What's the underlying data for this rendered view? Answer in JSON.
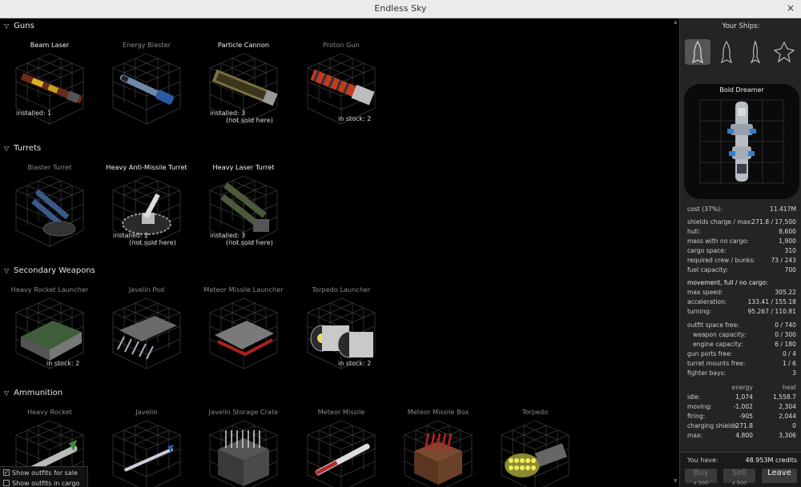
{
  "window": {
    "title": "Endless Sky",
    "close_glyph": "×"
  },
  "categories": [
    {
      "name": "Guns",
      "outfits": [
        {
          "name": "Beam Laser",
          "available": true,
          "status": "installed: 1",
          "art": "beam-laser"
        },
        {
          "name": "Energy Blaster",
          "available": false,
          "art": "energy-blaster"
        },
        {
          "name": "Particle Cannon",
          "available": true,
          "status": "installed: 3",
          "status2": "(not sold here)",
          "art": "particle-cannon"
        },
        {
          "name": "Proton Gun",
          "available": false,
          "status_right": "in stock: 2",
          "art": "proton-gun"
        }
      ]
    },
    {
      "name": "Turrets",
      "outfits": [
        {
          "name": "Blaster Turret",
          "available": false,
          "art": "blaster-turret"
        },
        {
          "name": "Heavy Anti-Missile Turret",
          "available": true,
          "status": "installed: 2",
          "status2": "(not sold here)",
          "art": "anti-missile-turret"
        },
        {
          "name": "Heavy Laser Turret",
          "available": true,
          "status": "installed: 3",
          "status2": "(not sold here)",
          "art": "laser-turret"
        }
      ]
    },
    {
      "name": "Secondary Weapons",
      "outfits": [
        {
          "name": "Heavy Rocket Launcher",
          "available": false,
          "status_right": "in stock: 2",
          "art": "rocket-launcher"
        },
        {
          "name": "Javelin Pod",
          "available": false,
          "art": "javelin-pod"
        },
        {
          "name": "Meteor Missile Launcher",
          "available": false,
          "art": "meteor-launcher"
        },
        {
          "name": "Torpedo Launcher",
          "available": false,
          "status_right": "in stock: 2",
          "art": "torpedo-launcher"
        }
      ]
    },
    {
      "name": "Ammunition",
      "outfits": [
        {
          "name": "Heavy Rocket",
          "available": false,
          "art": "heavy-rocket"
        },
        {
          "name": "Javelin",
          "available": false,
          "art": "javelin"
        },
        {
          "name": "Javelin Storage Crate",
          "available": false,
          "art": "javelin-crate"
        },
        {
          "name": "Meteor Missile",
          "available": false,
          "art": "meteor-missile"
        },
        {
          "name": "Meteor Missile Box",
          "available": false,
          "art": "meteor-box"
        },
        {
          "name": "Torpedo",
          "available": false,
          "art": "torpedo"
        }
      ]
    }
  ],
  "filters": {
    "show_for_sale": "Show outfits for sale",
    "show_in_cargo": "Show outfits in cargo",
    "for_sale_checked": true
  },
  "panel": {
    "heading": "Your Ships:",
    "ship_name": "Bold Dreamer",
    "stats": [
      {
        "label": "cost (37%):",
        "value": "11.417M"
      },
      {
        "label": "shields charge / max:",
        "value": "271.8 / 17,500"
      },
      {
        "label": "hull:",
        "value": "8,600"
      },
      {
        "label": "mass with no cargo:",
        "value": "1,900"
      },
      {
        "label": "cargo space:",
        "value": "310"
      },
      {
        "label": "required crew / bunks:",
        "value": "73 / 243"
      },
      {
        "label": "fuel capacity:",
        "value": "700"
      }
    ],
    "movement_heading": "movement, full / no cargo:",
    "movement": [
      {
        "label": "max speed:",
        "value": "305.22"
      },
      {
        "label": "acceleration:",
        "value": "133.41 / 155.18"
      },
      {
        "label": "turning:",
        "value": "95.267 / 110.81"
      }
    ],
    "capacity": [
      {
        "label": "outfit space free:",
        "value": "0 / 740"
      },
      {
        "label": "weapon capacity:",
        "value": "0 / 300",
        "indent": true
      },
      {
        "label": "engine capacity:",
        "value": "6 / 180",
        "indent": true
      },
      {
        "label": "gun ports free:",
        "value": "0 / 4"
      },
      {
        "label": "turret mounts free:",
        "value": "1 / 6"
      },
      {
        "label": "fighter bays:",
        "value": "3"
      }
    ],
    "energy_heat": {
      "col_energy": "energy",
      "col_heat": "heat",
      "rows": [
        {
          "label": "idle:",
          "energy": "1,074",
          "heat": "1,558.7"
        },
        {
          "label": "moving:",
          "energy": "-1,002",
          "heat": "2,304"
        },
        {
          "label": "firing:",
          "energy": "-905",
          "heat": "2,044"
        },
        {
          "label": "charging shields:",
          "energy": "-271.8",
          "heat": "0"
        },
        {
          "label": "max:",
          "energy": "4,800",
          "heat": "3,306"
        }
      ]
    },
    "you_have_label": "You have:",
    "credits": "48.953M credits",
    "buy": {
      "label": "Buy",
      "sub": "x 500"
    },
    "sell": {
      "label": "Sell",
      "sub": "x 500"
    },
    "leave": {
      "label": "Leave"
    }
  }
}
